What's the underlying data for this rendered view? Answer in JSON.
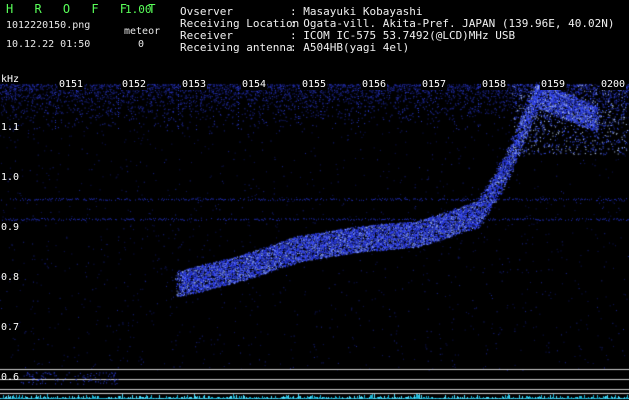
{
  "app": {
    "logo": "H R O F F T",
    "version": "1.00",
    "filename": "1012220150.png",
    "timestamp": "10.12.22 01:50",
    "meteor_label": "meteor",
    "meteor_count": "0"
  },
  "station": {
    "observer_label": "Ovserver",
    "observer_value": ": Masayuki Kobayashi",
    "location_label": "Receiving Location",
    "location_value": ": Ogata-vill. Akita-Pref. JAPAN (139.96E, 40.02N)",
    "receiver_label": "Receiver",
    "receiver_value": ": ICOM IC-575 53.7492(@LCD)MHz USB",
    "antenna_label": "Receiving antenna",
    "antenna_value": ": A504HB(yagi 4el)"
  },
  "chart_data": {
    "type": "heatmap",
    "ylabel": "kHz",
    "y_ticks": [
      "1.1",
      "1.0",
      "0.9",
      "0.8",
      "0.7",
      "0.6"
    ],
    "x_ticks": [
      "0151",
      "0152",
      "0153",
      "0154",
      "0155",
      "0156",
      "0157",
      "0158",
      "0159",
      "0200"
    ],
    "ylim": [
      0.58,
      1.19
    ],
    "baseline_khz": [
      0.92,
      0.96
    ],
    "trace": [
      {
        "t": "0153",
        "f": 0.79
      },
      {
        "t": "0154",
        "f": 0.82
      },
      {
        "t": "0155",
        "f": 0.86
      },
      {
        "t": "0156",
        "f": 0.88
      },
      {
        "t": "0157",
        "f": 0.89
      },
      {
        "t": "0158",
        "f": 0.93
      },
      {
        "t": "0158",
        "f": 1.02
      },
      {
        "t": "0159",
        "f": 1.17
      },
      {
        "t": "0200",
        "f": 1.12
      }
    ],
    "colors": {
      "signal": "#3344ff",
      "bright": "#aaccff",
      "lines": "#cfcfcf",
      "bottom": "#22ccee"
    }
  }
}
